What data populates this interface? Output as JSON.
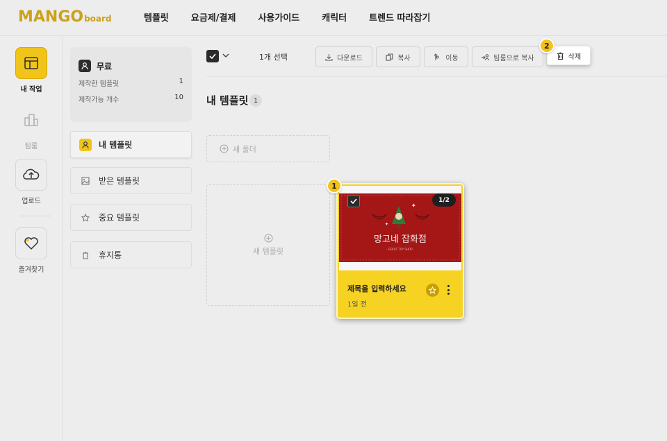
{
  "logo": {
    "main": "MANGO",
    "sub": "board"
  },
  "nav": [
    "템플릿",
    "요금제/결제",
    "사용가이드",
    "캐릭터",
    "트렌드 따라잡기"
  ],
  "rail": [
    {
      "label": "내 작업",
      "icon": "layout-icon"
    },
    {
      "label": "팀룸",
      "icon": "buildings-icon"
    },
    {
      "label": "업로드",
      "icon": "cloud-upload-icon"
    },
    {
      "label": "즐겨찾기",
      "icon": "heart-icon"
    }
  ],
  "quota": {
    "plan": "무료",
    "made_label": "제작한 템플릿",
    "made_value": "1",
    "available_label": "제작가능 개수",
    "available_value": "10"
  },
  "menu": [
    {
      "label": "내 템플릿",
      "icon": "user-icon"
    },
    {
      "label": "받은 템플릿",
      "icon": "image-icon"
    },
    {
      "label": "중요 템플릿",
      "icon": "star-icon"
    },
    {
      "label": "휴지통",
      "icon": "trash-icon"
    }
  ],
  "toolbar": {
    "selected": "1개 선택",
    "download": "다운로드",
    "copy": "복사",
    "move": "이동",
    "copy_to_team": "팀룸으로 복사",
    "delete": "삭제"
  },
  "section": {
    "title": "내 템플릿",
    "count": "1"
  },
  "new_folder": "새 폴더",
  "new_template": "새 템플릿",
  "card": {
    "page": "1/2",
    "thumb_text": "망고네 잡화점",
    "thumb_sub": "· GOOLT TOY SHOP ·",
    "title": "제목을 입력하세요",
    "date": "1일 전"
  },
  "steps": [
    "1",
    "2"
  ],
  "colors": {
    "accent": "#f0c419",
    "card": "#f6d222",
    "thumb": "#a51616"
  }
}
